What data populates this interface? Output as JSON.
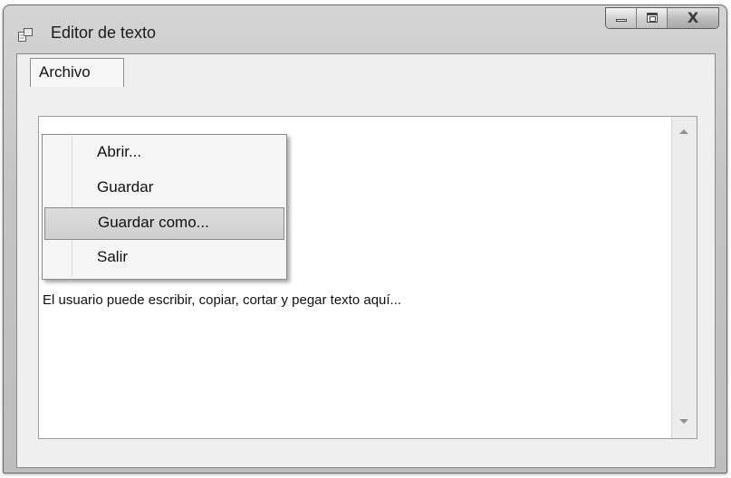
{
  "window": {
    "title": "Editor de texto",
    "icon": "window-app-icon",
    "controls": {
      "minimize": "minimize-icon",
      "maximize": "maximize-icon",
      "close": "X"
    }
  },
  "menubar": {
    "archivo": "Archivo"
  },
  "menu": {
    "items": [
      {
        "label": "Abrir..."
      },
      {
        "label": "Guardar"
      },
      {
        "label": "Guardar como...",
        "highlighted": true
      },
      {
        "label": "Salir"
      }
    ]
  },
  "editor": {
    "text": "El usuario puede escribir, copiar, cortar y pegar texto aquí..."
  }
}
